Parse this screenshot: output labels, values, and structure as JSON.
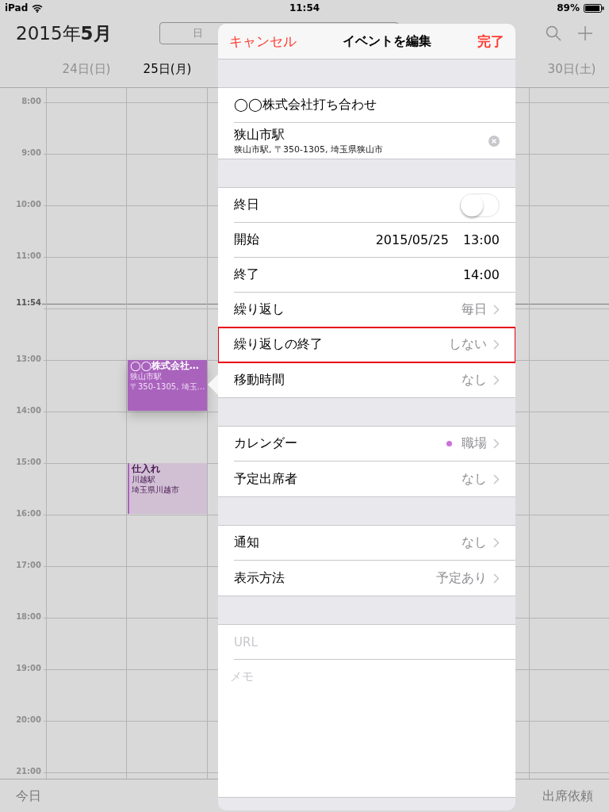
{
  "status_bar": {
    "device": "iPad",
    "time": "11:54",
    "battery": "89%"
  },
  "header": {
    "title": "2015年**5月**",
    "view_tabs": [
      {
        "label": "日",
        "selected": false
      }
    ]
  },
  "days": [
    {
      "label": "24日(日)",
      "selected": false
    },
    {
      "label": "25日(月)",
      "selected": true
    },
    {
      "label": "30日(土)",
      "selected": false
    }
  ],
  "time_rows": [
    {
      "label": "8:00",
      "kind": "hour"
    },
    {
      "label": "9:00",
      "kind": "hour"
    },
    {
      "label": "10:00",
      "kind": "hour"
    },
    {
      "label": "11:00",
      "kind": "hour"
    },
    {
      "label": "11:54",
      "kind": "now"
    },
    {
      "label": "13:00",
      "kind": "hour"
    },
    {
      "label": "14:00",
      "kind": "hour"
    },
    {
      "label": "15:00",
      "kind": "hour"
    },
    {
      "label": "16:00",
      "kind": "hour"
    },
    {
      "label": "17:00",
      "kind": "hour"
    },
    {
      "label": "18:00",
      "kind": "hour"
    },
    {
      "label": "19:00",
      "kind": "hour"
    },
    {
      "label": "20:00",
      "kind": "hour"
    },
    {
      "label": "21:00",
      "kind": "hour"
    }
  ],
  "events": [
    {
      "title": "◯◯株式会社…",
      "lines": [
        "狭山市駅",
        "〒350-1305, 埼玉…"
      ],
      "selected": true
    },
    {
      "title": "仕入れ",
      "lines": [
        "川越駅",
        "埼玉県川越市"
      ],
      "selected": false
    }
  ],
  "popover": {
    "cancel": "キャンセル",
    "title": "イベントを編集",
    "done": "完了",
    "event_title": "◯◯株式会社打ち合わせ",
    "location": {
      "name": "狭山市駅",
      "address": "狭山市駅, 〒350-1305, 埼玉県狭山市"
    },
    "sections": [
      [
        {
          "kind": "toggle",
          "label": "終日",
          "on": false,
          "highlighted": false
        },
        {
          "kind": "datetime",
          "label": "開始",
          "date": "2015/05/25",
          "time": "13:00",
          "highlighted": false
        },
        {
          "kind": "datetime",
          "label": "終了",
          "time": "14:00",
          "highlighted": false
        },
        {
          "kind": "link",
          "label": "繰り返し",
          "value": "毎日",
          "highlighted": false
        },
        {
          "kind": "link",
          "label": "繰り返しの終了",
          "value": "しない",
          "highlighted": true
        },
        {
          "kind": "link",
          "label": "移動時間",
          "value": "なし",
          "highlighted": false
        }
      ],
      [
        {
          "kind": "link",
          "label": "カレンダー",
          "value": "職場",
          "color": "#cc6fe0",
          "highlighted": false
        },
        {
          "kind": "link",
          "label": "予定出席者",
          "value": "なし",
          "highlighted": false
        }
      ],
      [
        {
          "kind": "link",
          "label": "通知",
          "value": "なし",
          "highlighted": false
        },
        {
          "kind": "link",
          "label": "表示方法",
          "value": "予定あり",
          "highlighted": false
        }
      ]
    ],
    "url": {
      "placeholder": "URL"
    },
    "notes": {
      "placeholder": "メモ"
    }
  },
  "toolbar": {
    "left": "今日",
    "right": "出席依頼"
  }
}
